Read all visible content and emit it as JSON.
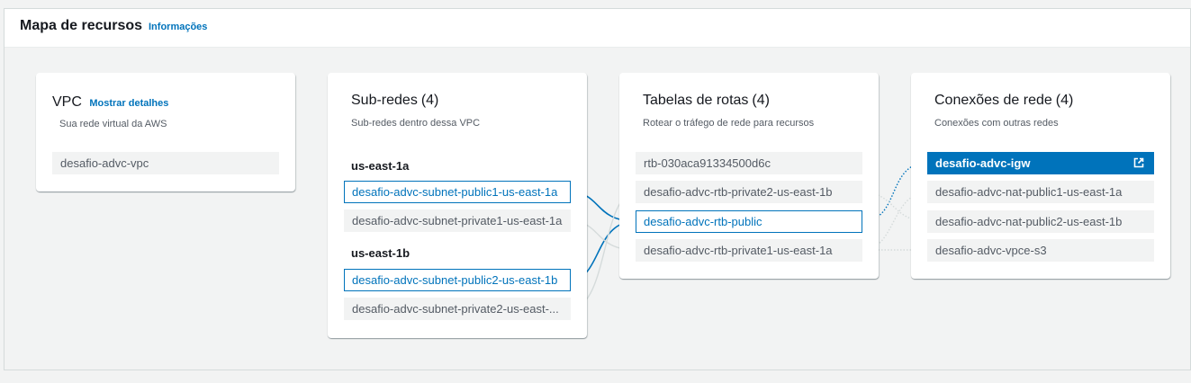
{
  "header": {
    "title": "Mapa de recursos",
    "info_link": "Informações"
  },
  "vpc": {
    "title": "VPC",
    "details_link": "Mostrar detalhes",
    "subtitle": "Sua rede virtual da AWS",
    "items": [
      "desafio-advc-vpc"
    ]
  },
  "subnets": {
    "title": "Sub-redes",
    "count": "(4)",
    "subtitle": "Sub-redes dentro dessa VPC",
    "groups": [
      {
        "label": "us-east-1a",
        "items": [
          "desafio-advc-subnet-public1-us-east-1a",
          "desafio-advc-subnet-private1-us-east-1a"
        ]
      },
      {
        "label": "us-east-1b",
        "items": [
          "desafio-advc-subnet-public2-us-east-1b",
          "desafio-advc-subnet-private2-us-east-..."
        ]
      }
    ]
  },
  "route_tables": {
    "title": "Tabelas de rotas",
    "count": "(4)",
    "subtitle": "Rotear o tráfego de rede para recursos",
    "items": [
      "rtb-030aca91334500d6c",
      "desafio-advc-rtb-private2-us-east-1b",
      "desafio-advc-rtb-public",
      "desafio-advc-rtb-private1-us-east-1a"
    ]
  },
  "connections": {
    "title": "Conexões de rede",
    "count": "(4)",
    "subtitle": "Conexões com outras redes",
    "items": [
      "desafio-advc-igw",
      "desafio-advc-nat-public1-us-east-1a",
      "desafio-advc-nat-public2-us-east-1b",
      "desafio-advc-vpce-s3"
    ]
  },
  "colors": {
    "accent": "#0073bb",
    "link": "#0073bb",
    "muted_line": "#d5dbdb"
  },
  "icons": {
    "external_link": "external-link-icon"
  }
}
